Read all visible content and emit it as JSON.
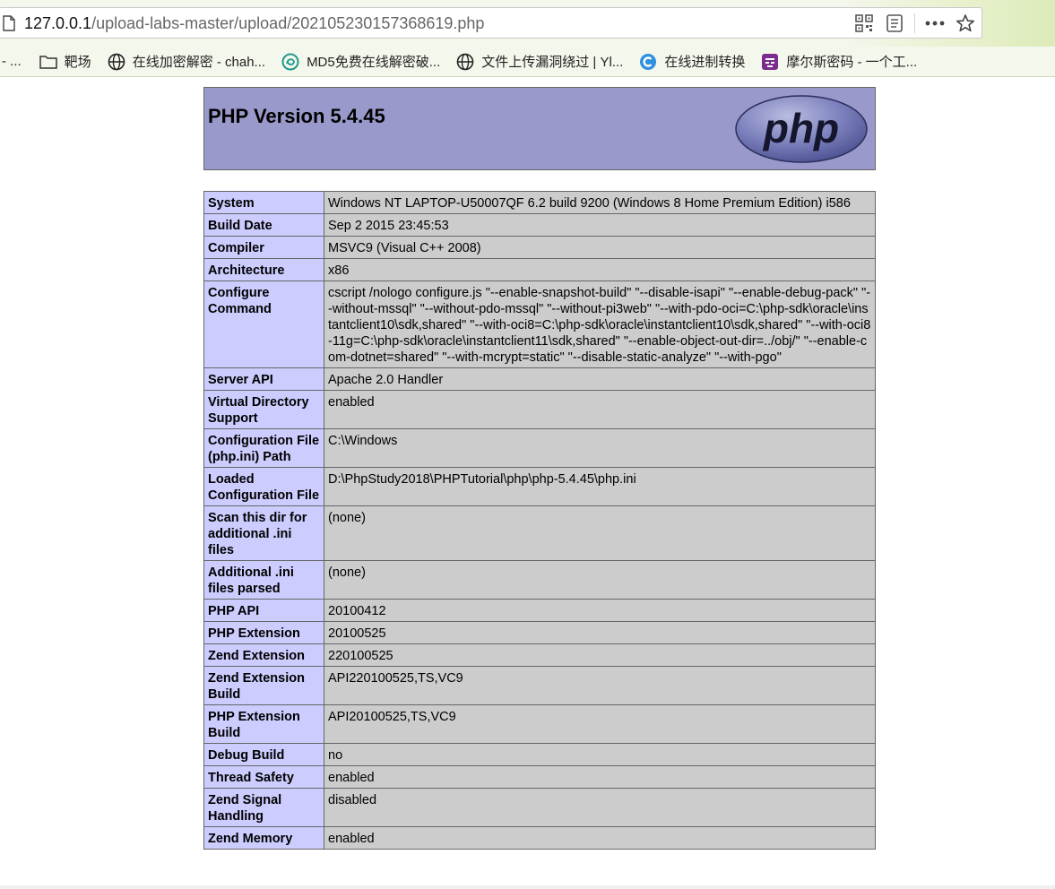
{
  "browser": {
    "url_host": "127.0.0.1",
    "url_path": "/upload-labs-master/upload/202105230157368619.php",
    "bookmarks": [
      {
        "label": "- ...",
        "icon": "none"
      },
      {
        "label": "靶场",
        "icon": "folder-icon"
      },
      {
        "label": "在线加密解密 - chah...",
        "icon": "globe-icon"
      },
      {
        "label": "MD5免费在线解密破...",
        "icon": "md5-site-icon"
      },
      {
        "label": "文件上传漏洞绕过 | Yl...",
        "icon": "globe-icon"
      },
      {
        "label": "在线进制转换",
        "icon": "c-site-icon"
      },
      {
        "label": "摩尔斯密码 - 一个工...",
        "icon": "morse-site-icon"
      }
    ]
  },
  "page": {
    "title": "PHP Version 5.4.45",
    "logo_text": "php",
    "colors": {
      "header": "#9999cc",
      "label_cell": "#ccccff",
      "value_cell": "#cccccc"
    },
    "rows": [
      {
        "label": "System",
        "value": "Windows NT LAPTOP-U50007QF 6.2 build 9200 (Windows 8 Home Premium Edition) i586"
      },
      {
        "label": "Build Date",
        "value": "Sep 2 2015 23:45:53"
      },
      {
        "label": "Compiler",
        "value": "MSVC9 (Visual C++ 2008)"
      },
      {
        "label": "Architecture",
        "value": "x86"
      },
      {
        "label": "Configure Command",
        "value": "cscript /nologo configure.js \"--enable-snapshot-build\" \"--disable-isapi\" \"--enable-debug-pack\" \"--without-mssql\" \"--without-pdo-mssql\" \"--without-pi3web\" \"--with-pdo-oci=C:\\php-sdk\\oracle\\instantclient10\\sdk,shared\" \"--with-oci8=C:\\php-sdk\\oracle\\instantclient10\\sdk,shared\" \"--with-oci8-11g=C:\\php-sdk\\oracle\\instantclient11\\sdk,shared\" \"--enable-object-out-dir=../obj/\" \"--enable-com-dotnet=shared\" \"--with-mcrypt=static\" \"--disable-static-analyze\" \"--with-pgo\""
      },
      {
        "label": "Server API",
        "value": "Apache 2.0 Handler"
      },
      {
        "label": "Virtual Directory Support",
        "value": "enabled"
      },
      {
        "label": "Configuration File (php.ini) Path",
        "value": "C:\\Windows"
      },
      {
        "label": "Loaded Configuration File",
        "value": "D:\\PhpStudy2018\\PHPTutorial\\php\\php-5.4.45\\php.ini"
      },
      {
        "label": "Scan this dir for additional .ini files",
        "value": "(none)"
      },
      {
        "label": "Additional .ini files parsed",
        "value": "(none)"
      },
      {
        "label": "PHP API",
        "value": "20100412"
      },
      {
        "label": "PHP Extension",
        "value": "20100525"
      },
      {
        "label": "Zend Extension",
        "value": "220100525"
      },
      {
        "label": "Zend Extension Build",
        "value": "API220100525,TS,VC9"
      },
      {
        "label": "PHP Extension Build",
        "value": "API20100525,TS,VC9"
      },
      {
        "label": "Debug Build",
        "value": "no"
      },
      {
        "label": "Thread Safety",
        "value": "enabled"
      },
      {
        "label": "Zend Signal Handling",
        "value": "disabled"
      },
      {
        "label": "Zend Memory",
        "value": "enabled"
      }
    ]
  }
}
